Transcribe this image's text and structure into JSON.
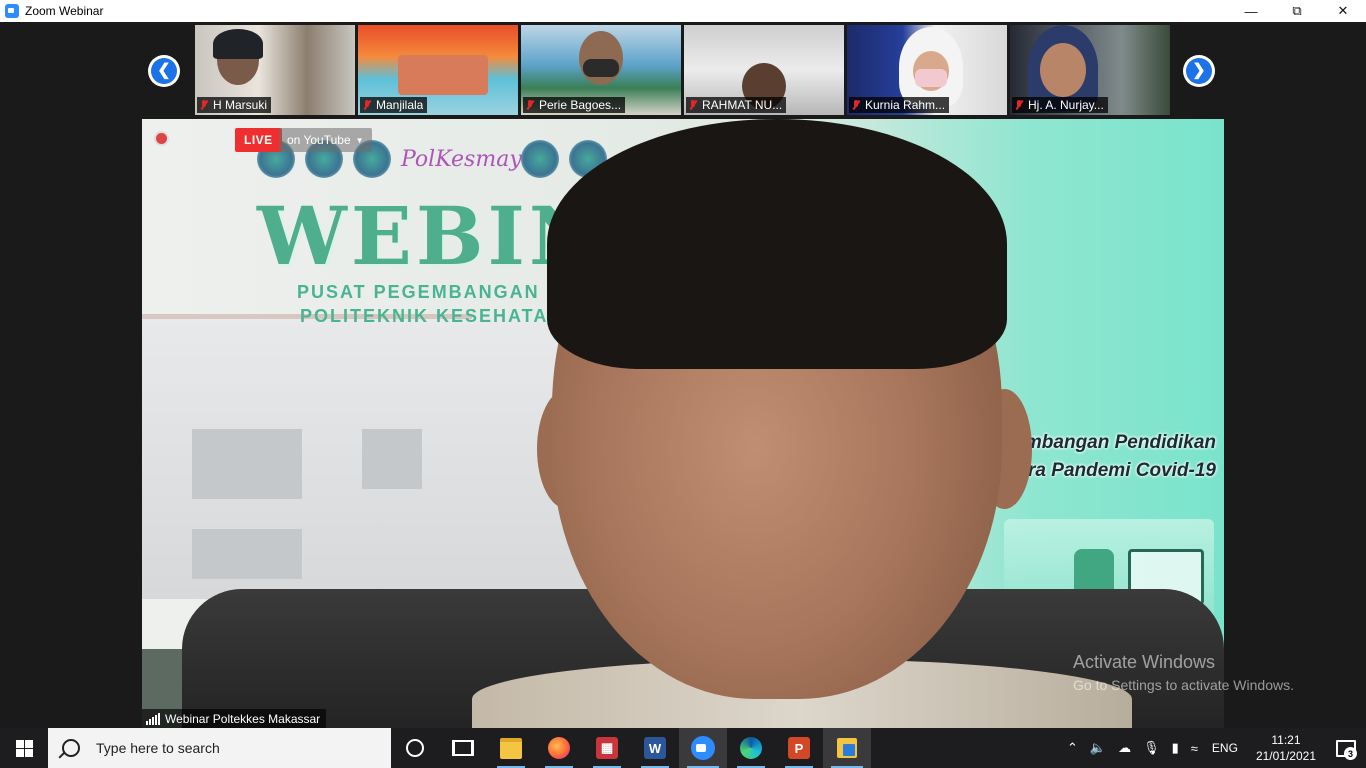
{
  "window": {
    "title": "Zoom Webinar",
    "controls": {
      "minimize": "—",
      "maximize": "⧉",
      "close": "✕"
    }
  },
  "gallery": {
    "prev_icon": "chevron-left",
    "next_icon": "chevron-right",
    "participants": [
      {
        "name": "H Marsuki",
        "muted": true
      },
      {
        "name": "Manjilala",
        "muted": true
      },
      {
        "name": "Perie Bagoes...",
        "muted": true
      },
      {
        "name": "RAHMAT NU...",
        "muted": true
      },
      {
        "name": "Kurnia Rahm...",
        "muted": true
      },
      {
        "name": "Hj. A. Nurjay...",
        "muted": true
      }
    ]
  },
  "main_video": {
    "live_label": "LIVE",
    "live_target": "on YouTube",
    "participant_name": "Webinar Poltekkes Makassar",
    "background": {
      "logo_text": "PolKesmay",
      "title": "WEBINA",
      "subtitle_1": "PUSAT PEGEMBANGAN PEN",
      "subtitle_2": "POLITEKNIK KESEHATAN MA",
      "theme_line_1": "mbangan Pendidikan",
      "theme_line_2": "ara Pandemi Covid-19"
    }
  },
  "watermark": {
    "line1": "Activate Windows",
    "line2": "Go to Settings to activate Windows."
  },
  "taskbar": {
    "search_placeholder": "Type here to search",
    "apps": [
      "cortana",
      "task-view",
      "file-explorer",
      "firefox",
      "app-red",
      "word",
      "zoom",
      "edge",
      "powerpoint",
      "files"
    ],
    "language": "ENG",
    "time": "11:21",
    "date": "21/01/2021",
    "notification_count": "3"
  },
  "colors": {
    "live_red": "#ef2f2f",
    "accent_blue": "#1c72e6",
    "mute_red": "#e02828",
    "zoom_blue": "#2d8cff"
  }
}
